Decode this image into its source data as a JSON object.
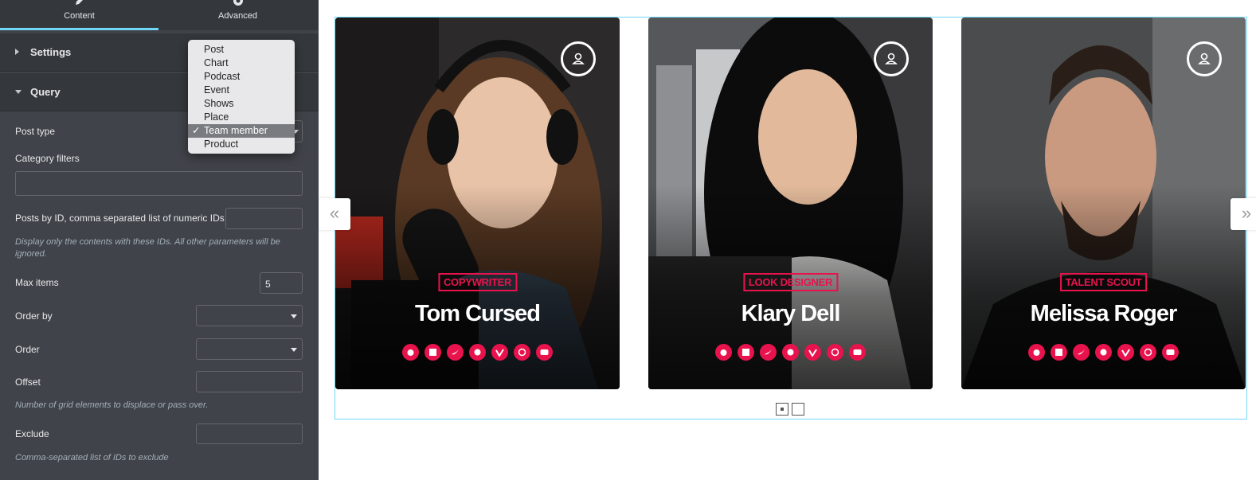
{
  "panel": {
    "tabs": [
      {
        "label": "Content",
        "icon": "pencil-icon"
      },
      {
        "label": "Advanced",
        "icon": "gear-icon"
      }
    ],
    "sections": {
      "settings": "Settings",
      "query": "Query"
    },
    "fields": {
      "post_type": {
        "label": "Post type"
      },
      "category_filters": {
        "label": "Category filters",
        "value": ""
      },
      "posts_by_id": {
        "label": "Posts by ID, comma separated list of numeric IDs",
        "value": "",
        "note": "Display only the contents with these IDs. All other parameters will be ignored."
      },
      "max_items": {
        "label": "Max items",
        "value": "5"
      },
      "order_by": {
        "label": "Order by",
        "value": ""
      },
      "order": {
        "label": "Order",
        "value": ""
      },
      "offset": {
        "label": "Offset",
        "value": "",
        "note": "Number of grid elements to displace or pass over."
      },
      "exclude": {
        "label": "Exclude",
        "value": "",
        "note": "Comma-separated list of IDs to exclude"
      }
    },
    "post_type_menu": {
      "options": [
        "Post",
        "Chart",
        "Podcast",
        "Event",
        "Shows",
        "Place",
        "Team member",
        "Product"
      ],
      "selected": "Team member",
      "check": "✓"
    }
  },
  "carousel": {
    "prev": "«",
    "next": "»",
    "cards": [
      {
        "role": "COPYWRITER",
        "name": "Tom Cursed"
      },
      {
        "role": "LOOK DESIGNER",
        "name": "Klary Dell"
      },
      {
        "role": "TALENT SCOUT",
        "name": "Melissa Roger"
      }
    ],
    "social_icons": [
      "apple-icon",
      "facebook-icon",
      "twitter-icon",
      "pinterest-icon",
      "vimeo-icon",
      "wordpress-icon",
      "youtube-icon"
    ],
    "pagination": {
      "pages": 2,
      "current": 1
    }
  },
  "colors": {
    "accent": "#e8134d",
    "panel_bg": "#404349",
    "tab_active": "#71d7f7"
  }
}
